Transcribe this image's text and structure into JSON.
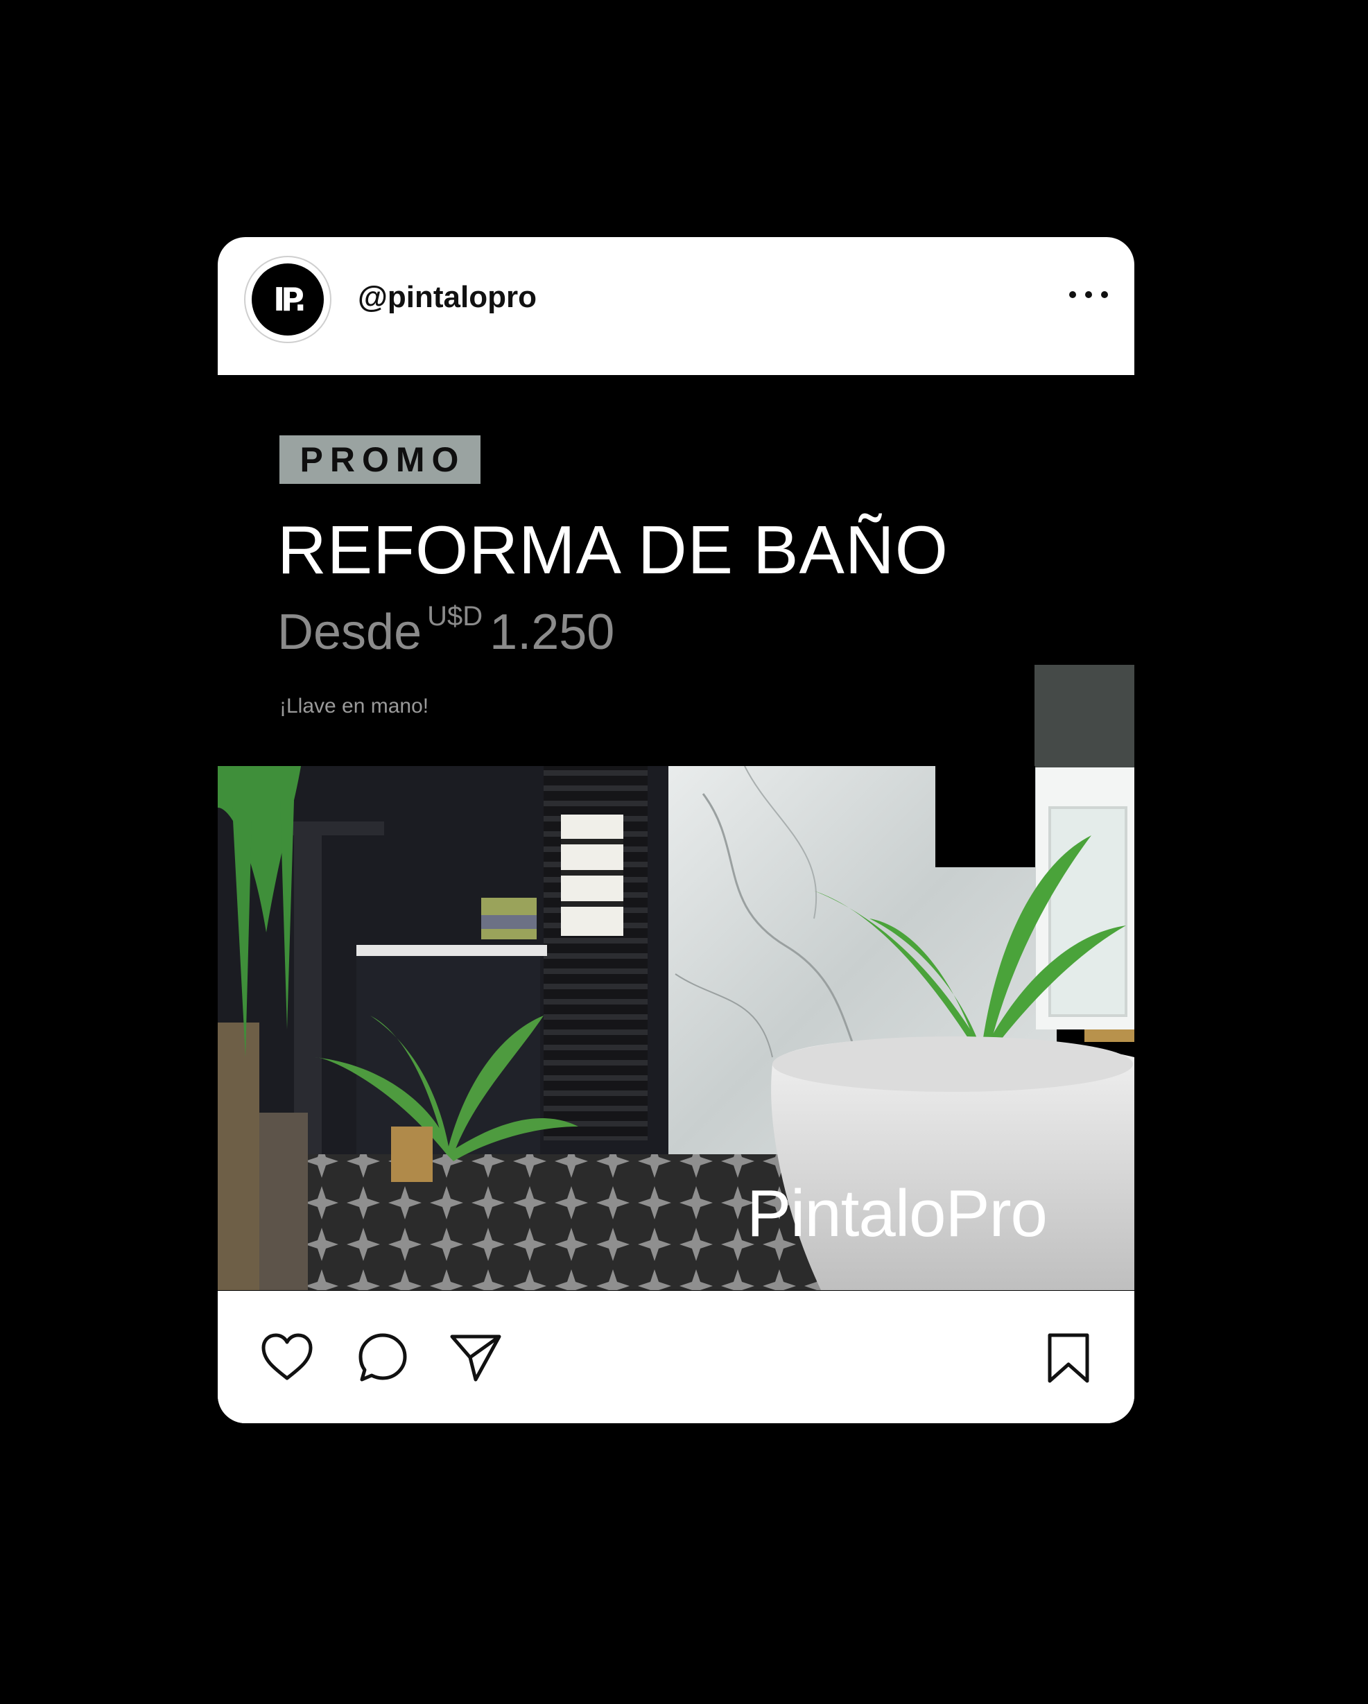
{
  "post": {
    "username": "@pintalopro",
    "avatar_monogram": "IP.",
    "promo_badge": "PROMO",
    "headline": "REFORMA DE BAÑO",
    "price_prefix": "Desde",
    "price_currency": "U$D",
    "price_amount": "1.250",
    "tagline": "¡Llave en mano!",
    "brand_logo": "PintaloPro"
  },
  "icons": {
    "more": "more-horizontal-icon",
    "like": "heart-icon",
    "comment": "comment-icon",
    "share": "send-icon",
    "save": "bookmark-icon"
  },
  "colors": {
    "background": "#000000",
    "card": "#ffffff",
    "badge": "#9aa3a1",
    "accent_grey": "#454a48",
    "price_text": "#8b8b8b"
  }
}
